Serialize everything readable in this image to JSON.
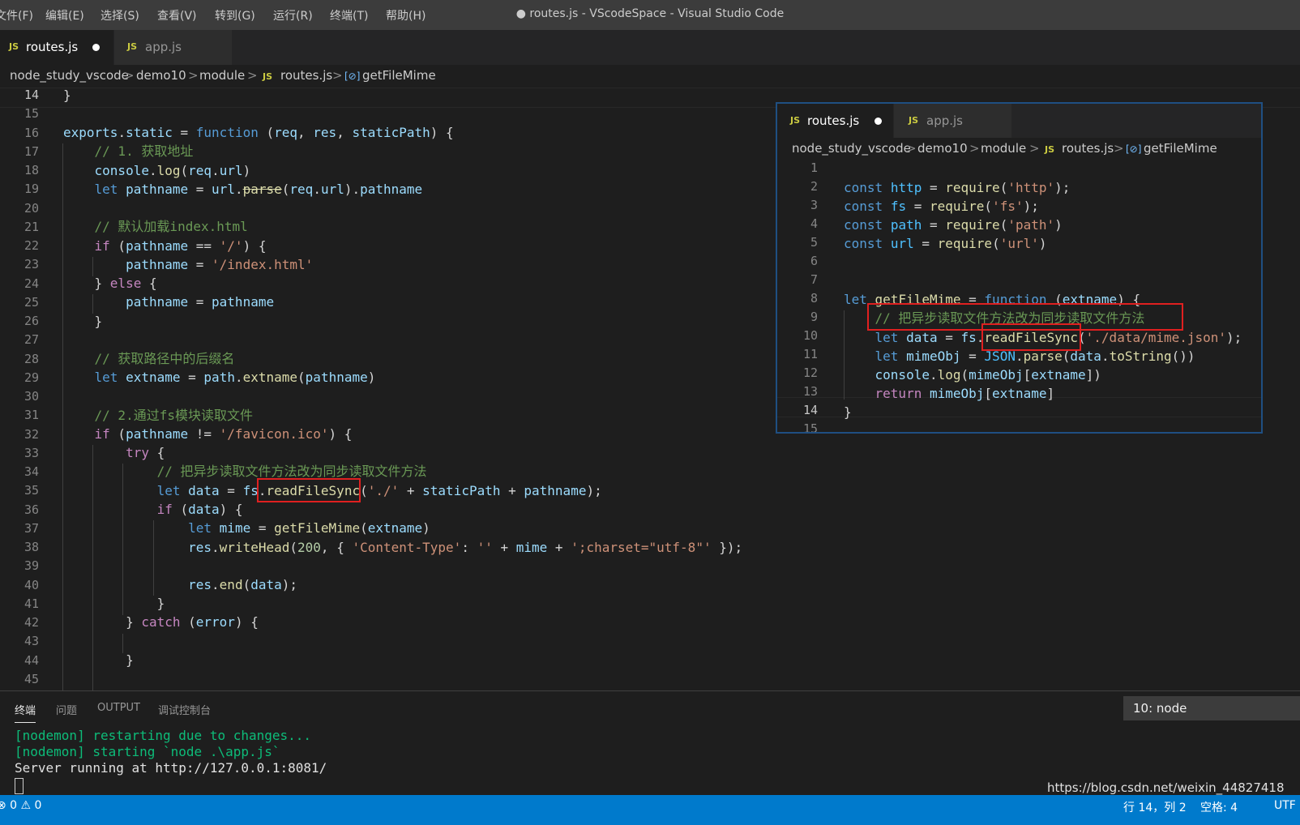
{
  "window": {
    "title": "● routes.js - VScodeSpace - Visual Studio Code"
  },
  "menu": [
    "文件(F)",
    "编辑(E)",
    "选择(S)",
    "查看(V)",
    "转到(G)",
    "运行(R)",
    "终端(T)",
    "帮助(H)"
  ],
  "tabs": [
    {
      "label": "routes.js",
      "badge": "JS",
      "dirty": true
    },
    {
      "label": "app.js",
      "badge": "JS",
      "dirty": false
    }
  ],
  "breadcrumb": [
    "node_study_vscode",
    "demo10",
    "module",
    "routes.js",
    "getFileMime"
  ],
  "breadcrumb_sep": ">",
  "symbol_badge": "[⊘]",
  "editor": {
    "current_line": "14",
    "line_numbers": [
      "14",
      "15",
      "16",
      "17",
      "18",
      "19",
      "20",
      "21",
      "22",
      "23",
      "24",
      "25",
      "26",
      "27",
      "28",
      "29",
      "30",
      "31",
      "32",
      "33",
      "34",
      "35",
      "36",
      "37",
      "38",
      "39",
      "40",
      "41",
      "42",
      "43",
      "44",
      "45"
    ]
  },
  "overlay": {
    "tabs": [
      {
        "label": "routes.js",
        "badge": "JS"
      },
      {
        "label": "app.js",
        "badge": "JS"
      }
    ],
    "breadcrumb": [
      "node_study_vscode",
      "demo10",
      "module",
      "routes.js",
      "getFileMime"
    ],
    "line_numbers": [
      "1",
      "2",
      "3",
      "4",
      "5",
      "6",
      "7",
      "8",
      "9",
      "10",
      "11",
      "12",
      "13",
      "14",
      "15"
    ],
    "current_line": "14"
  },
  "panel": {
    "tabs": [
      "终端",
      "问题",
      "OUTPUT",
      "调试控制台"
    ],
    "terminal_select": "10: node",
    "lines": [
      "[nodemon] restarting due to changes...",
      "[nodemon] starting `node .\\app.js`",
      "Server running at http://127.0.0.1:8081/"
    ]
  },
  "statusbar": {
    "left": "⊗ 0  ⚠ 0",
    "position": "行 14，列 2",
    "spaces": "空格: 4",
    "encoding": "UTF"
  },
  "watermark": "https://blog.csdn.net/weixin_44827418",
  "colors": {
    "statusbar": "#007acc",
    "highlight_box": "#e02020"
  }
}
